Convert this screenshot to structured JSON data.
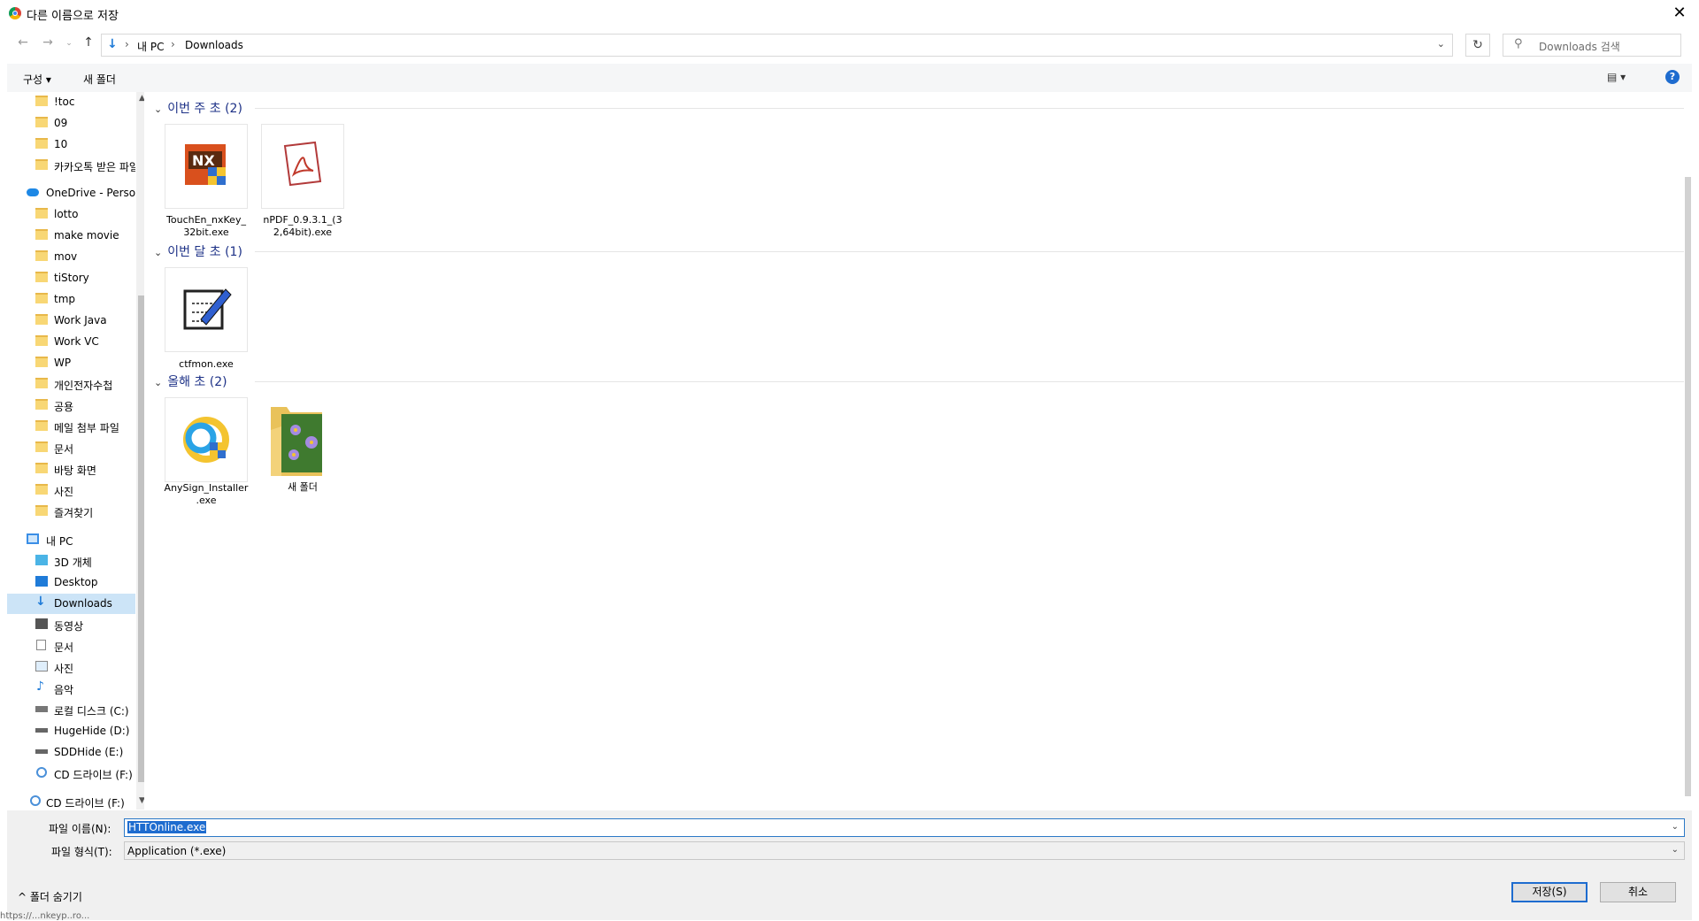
{
  "window": {
    "title": "다른 이름으로 저장"
  },
  "addressbar": {
    "mypc": "내 PC",
    "current": "Downloads",
    "sep": "›"
  },
  "search": {
    "placeholder": "Downloads 검색"
  },
  "commandbar": {
    "organize": "구성 ▾",
    "new_folder": "새 폴더",
    "view": "▤ ▾",
    "help": "?"
  },
  "nav": {
    "items": [
      {
        "label": "!toc"
      },
      {
        "label": "09"
      },
      {
        "label": "10"
      },
      {
        "label": "카카오톡 받은 파일"
      },
      {
        "label": "OneDrive - Personal"
      },
      {
        "label": "lotto"
      },
      {
        "label": "make movie"
      },
      {
        "label": "mov"
      },
      {
        "label": "tiStory"
      },
      {
        "label": "tmp"
      },
      {
        "label": "Work Java"
      },
      {
        "label": "Work VC"
      },
      {
        "label": "WP"
      },
      {
        "label": "개인전자수첩"
      },
      {
        "label": "공용"
      },
      {
        "label": "메일 첨부 파일"
      },
      {
        "label": "문서"
      },
      {
        "label": "바탕 화면"
      },
      {
        "label": "사진"
      },
      {
        "label": "즐겨찾기"
      },
      {
        "label": "내 PC"
      },
      {
        "label": "3D 개체"
      },
      {
        "label": "Desktop"
      },
      {
        "label": "Downloads"
      },
      {
        "label": "동영상"
      },
      {
        "label": "문서"
      },
      {
        "label": "사진"
      },
      {
        "label": "음악"
      },
      {
        "label": "로컬 디스크 (C:)"
      },
      {
        "label": "HugeHide (D:)"
      },
      {
        "label": "SDDHide (E:)"
      },
      {
        "label": "CD 드라이브 (F:)"
      },
      {
        "label": "CD 드라이브 (F:)"
      }
    ]
  },
  "groups": [
    {
      "header": "이번 주 초 (2)"
    },
    {
      "header": "이번 달 초 (1)"
    },
    {
      "header": "올해 초 (2)"
    }
  ],
  "files": [
    {
      "name": "TouchEn_nxKey_32bit.exe",
      "line1": "TouchEn_nxKey_",
      "line2": "32bit.exe"
    },
    {
      "name": "nPDF_0.9.3.1_(32,64bit).exe",
      "line1": "nPDF_0.9.3.1_(3",
      "line2": "2,64bit).exe"
    },
    {
      "name": "ctfmon.exe",
      "line1": "ctfmon.exe",
      "line2": ""
    },
    {
      "name": "AnySign_Installer.exe",
      "line1": "AnySign_Installer",
      "line2": ".exe"
    },
    {
      "name": "새 폴더",
      "line1": "새 폴더",
      "line2": ""
    }
  ],
  "form": {
    "filename_label": "파일 이름(N):",
    "filename_value": "HTTOnline.exe",
    "filetype_label": "파일 형식(T):",
    "filetype_value": "Application (*.exe)"
  },
  "footer": {
    "hide_folders": "^  폴더 숨기기",
    "save": "저장(S)",
    "cancel": "취소"
  },
  "status": {
    "url": "https://...nkeyp..ro..."
  }
}
